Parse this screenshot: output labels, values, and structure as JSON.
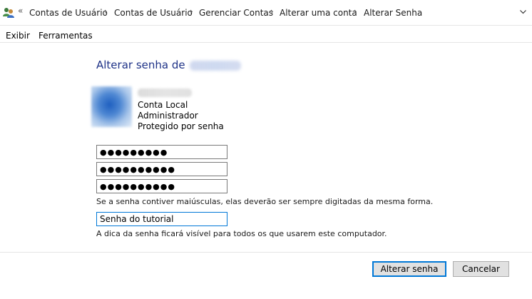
{
  "address_bar": {
    "icon": "user-accounts-icon",
    "overflow": "«",
    "crumbs": [
      "Contas de Usuário",
      "Contas de Usuário",
      "Gerenciar Contas",
      "Alterar uma conta",
      "Alterar Senha"
    ],
    "separator": "›"
  },
  "menu": {
    "items": [
      "Exibir",
      "Ferramentas"
    ]
  },
  "main": {
    "title": "Alterar senha de",
    "account": {
      "type": "Conta Local",
      "role": "Administrador",
      "status": "Protegido por senha"
    },
    "fields": {
      "current_password": "●●●●●●●●●",
      "new_password": "●●●●●●●●●●",
      "confirm_password": "●●●●●●●●●●",
      "hint": "Senha do tutorial"
    },
    "case_note": "Se a senha contiver maiúsculas, elas deverão ser sempre digitadas da mesma forma.",
    "hint_note": "A dica da senha ficará visível para todos os que usarem este computador."
  },
  "buttons": {
    "change": "Alterar senha",
    "cancel": "Cancelar"
  },
  "colors": {
    "title": "#1e3287",
    "accent": "#0078d7"
  }
}
